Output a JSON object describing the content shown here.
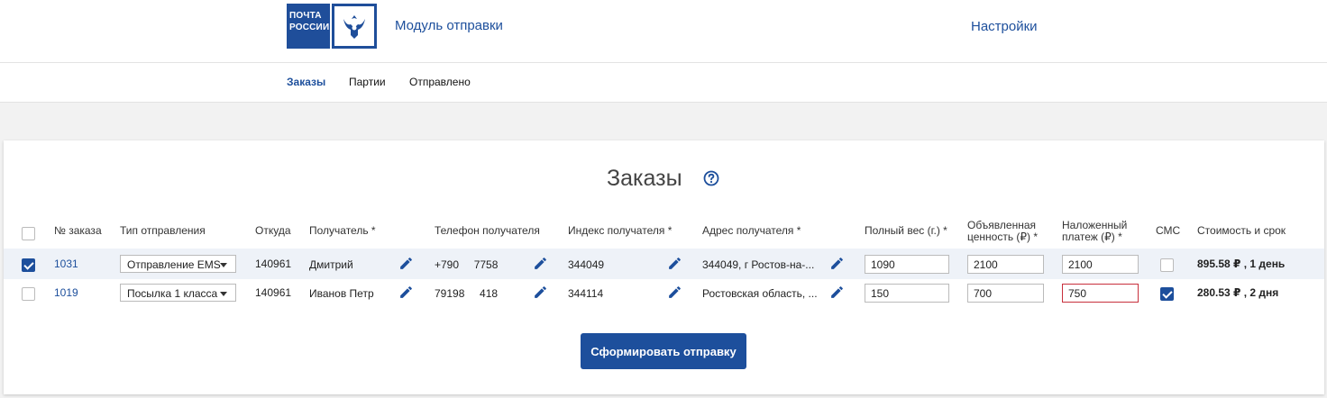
{
  "header": {
    "logo_line1": "ПОЧТА",
    "logo_line2": "РОССИИ",
    "app_title": "Модуль отправки",
    "settings_label": "Настройки"
  },
  "nav": {
    "tabs": [
      {
        "label": "Заказы",
        "active": true
      },
      {
        "label": "Партии",
        "active": false
      },
      {
        "label": "Отправлено",
        "active": false
      }
    ]
  },
  "orders": {
    "title": "Заказы",
    "columns": {
      "order_no": "№ заказа",
      "ship_type": "Тип отправления",
      "from": "Откуда",
      "recipient": "Получатель *",
      "phone": "Телефон получателя",
      "index": "Индекс получателя *",
      "address": "Адрес получателя *",
      "weight": "Полный вес (г.) *",
      "declared_value_1": "Объявленная",
      "declared_value_2": "ценность (₽) *",
      "cod_1": "Наложенный",
      "cod_2": "платеж (₽) *",
      "sms": "СМС",
      "cost": "Стоимость и срок"
    },
    "rows": [
      {
        "selected": true,
        "order_no": "1031",
        "ship_type": "Отправление EMS",
        "from": "140961",
        "recipient": "Дмитрий",
        "phone": "+790     7758",
        "index": "344049",
        "address": "344049, г Ростов-на-...",
        "weight": "1090",
        "declared_value": "2100",
        "cod": "2100",
        "sms": false,
        "cost": "895.58 ₽ , 1 день"
      },
      {
        "selected": false,
        "order_no": "1019",
        "ship_type": "Посылка 1 класса",
        "from": "140961",
        "recipient": "Иванов Петр",
        "phone": "79198     418",
        "index": "344114",
        "address": "Ростовская область, ...",
        "weight": "150",
        "declared_value": "700",
        "cod": "750",
        "sms": true,
        "cost": "280.53 ₽ , 2 дня"
      }
    ],
    "submit_label": "Сформировать отправку"
  },
  "colors": {
    "brand_blue": "#1d4f9c",
    "error_red": "#c8303c"
  }
}
